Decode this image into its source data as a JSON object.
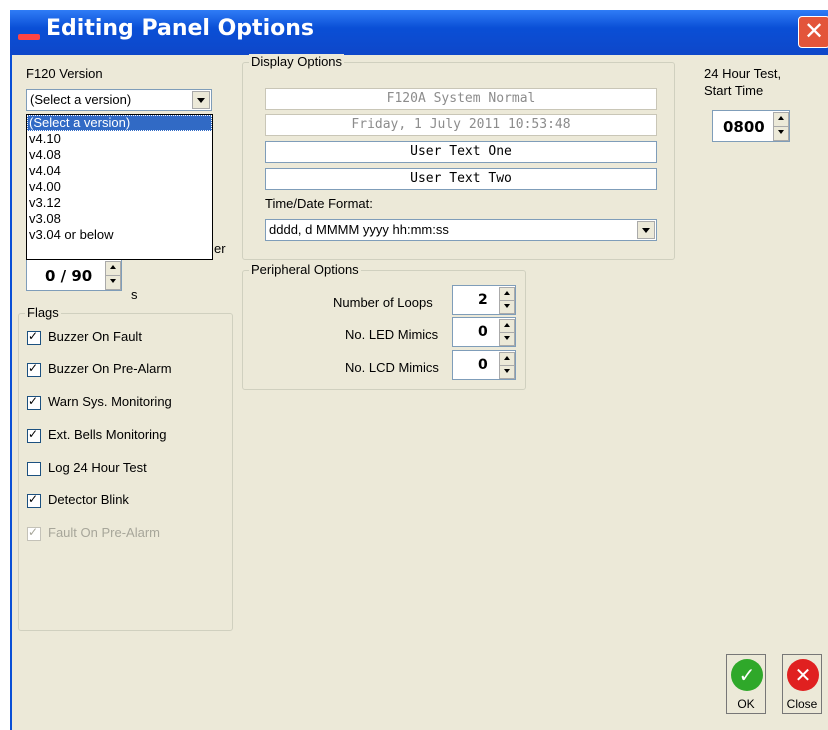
{
  "window": {
    "title": "Editing Panel Options"
  },
  "version": {
    "label": "F120 Version",
    "selected": "(Select a version)",
    "options": [
      "(Select a version)",
      "v4.10",
      "v4.08",
      "v4.04",
      "v4.00",
      "v3.12",
      "v3.08",
      "v3.04 or below"
    ],
    "hidden_label_tail": "er"
  },
  "delay": {
    "value": "0 / 90",
    "unit": "s"
  },
  "flags": {
    "caption": "Flags",
    "items": [
      {
        "label": "Buzzer On Fault",
        "checked": true,
        "enabled": true
      },
      {
        "label": "Buzzer On Pre-Alarm",
        "checked": true,
        "enabled": true
      },
      {
        "label": "Warn Sys. Monitoring",
        "checked": true,
        "enabled": true
      },
      {
        "label": "Ext. Bells Monitoring",
        "checked": true,
        "enabled": true
      },
      {
        "label": "Log 24 Hour Test",
        "checked": false,
        "enabled": true
      },
      {
        "label": "Detector Blink",
        "checked": true,
        "enabled": true
      },
      {
        "label": "Fault On Pre-Alarm",
        "checked": true,
        "enabled": false
      }
    ]
  },
  "display": {
    "caption": "Display Options",
    "lines": [
      "F120A System Normal",
      "Friday, 1 July 2011 10:53:48",
      "User Text One",
      "User Text Two"
    ],
    "format_label": "Time/Date Format:",
    "format_value": "dddd, d MMMM yyyy hh:mm:ss"
  },
  "peripheral": {
    "caption": "Peripheral Options",
    "loops_label": "Number of Loops",
    "loops_value": "2",
    "led_label": "No. LED Mimics",
    "led_value": "0",
    "lcd_label": "No. LCD Mimics",
    "lcd_value": "0"
  },
  "test": {
    "label_line1": "24 Hour Test,",
    "label_line2": "Start Time",
    "value": "0800"
  },
  "buttons": {
    "ok": "OK",
    "close": "Close"
  },
  "colors": {
    "title_bar": "#0a4fd6",
    "ok_green": "#2fa82a",
    "close_red": "#e02020",
    "selection": "#316ac5"
  }
}
